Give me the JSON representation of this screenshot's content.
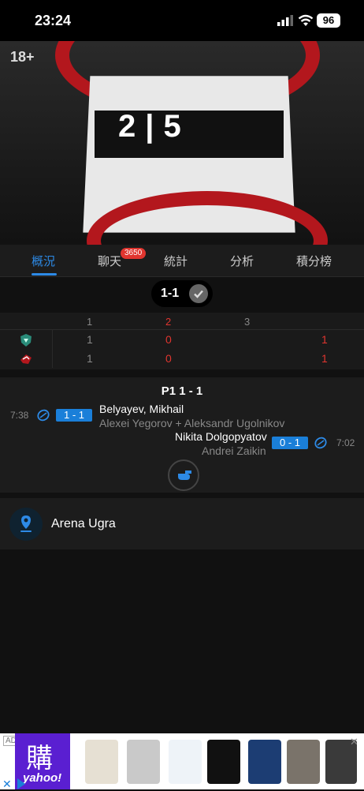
{
  "status": {
    "time": "23:24",
    "battery": "96"
  },
  "hero": {
    "age_rating": "18+",
    "board_score": "2|5"
  },
  "tabs": [
    {
      "label": "概況",
      "active": true
    },
    {
      "label": "聊天",
      "badge": "3650"
    },
    {
      "label": "統計"
    },
    {
      "label": "分析"
    },
    {
      "label": "積分榜"
    }
  ],
  "score_pill": {
    "score": "1-1"
  },
  "period_table": {
    "headers": [
      "1",
      "2",
      "3"
    ],
    "rows": [
      {
        "team_icon": "team-logo-green",
        "values": [
          "1",
          "0",
          "",
          "1"
        ]
      },
      {
        "team_icon": "team-logo-red",
        "values": [
          "1",
          "0",
          "",
          "1"
        ]
      }
    ]
  },
  "events": {
    "period_title": "P1 1 - 1",
    "items": [
      {
        "time": "7:38",
        "score": "1 - 1",
        "scorer": "Belyayev, Mikhail",
        "assists": "Alexei Yegorov + Aleksandr Ugolnikov",
        "side": "home",
        "icon": "puck-icon"
      },
      {
        "time": "7:02",
        "score": "0 - 1",
        "scorer": "Nikita Dolgopyatov",
        "assists": "Andrei Zaikin",
        "side": "away",
        "icon": "puck-icon"
      }
    ]
  },
  "venue": {
    "name": "Arena Ugra",
    "icon": "location-pin-icon"
  },
  "ad": {
    "tag": "AD",
    "brand": "yahoo!",
    "brand_char": "購"
  },
  "colors": {
    "accent": "#2d8ae6",
    "score_box": "#1a7fd9",
    "red": "#e0352f",
    "badge": "#e0352f"
  }
}
